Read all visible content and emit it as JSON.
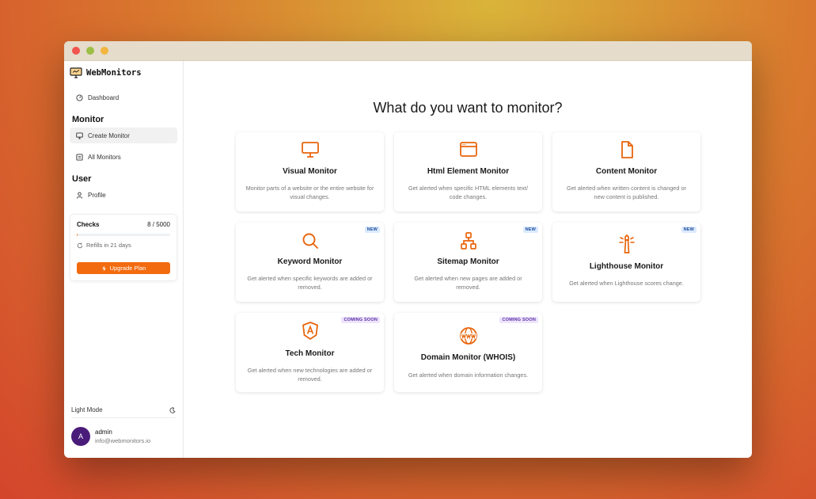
{
  "brand": {
    "name": "WebMonitors",
    "accent": "#f26b0f"
  },
  "sidebar": {
    "dashboard": "Dashboard",
    "sections": [
      {
        "title": "Monitor",
        "items": [
          "Create Monitor",
          "All Monitors"
        ]
      },
      {
        "title": "User",
        "items": [
          "Profile"
        ]
      }
    ],
    "checks": {
      "label": "Checks",
      "value": "8 / 5000",
      "used": 8,
      "limit": 5000,
      "refill": "Refills in 21 days",
      "upgrade": "Upgrade Plan"
    },
    "mode": "Light Mode",
    "user": {
      "initial": "A",
      "name": "admin",
      "email": "info@webmonitors.io"
    }
  },
  "main": {
    "title": "What do you want to monitor?",
    "cards": [
      {
        "name": "Visual Monitor",
        "desc": "Monitor parts of a website or the entire website for visual changes.",
        "icon": "monitor-icon",
        "badge": ""
      },
      {
        "name": "Html Element Monitor",
        "desc": "Get alerted when specific HTML elements text/ code changes.",
        "icon": "browser-window-icon",
        "badge": ""
      },
      {
        "name": "Content Monitor",
        "desc": "Get alerted when written content is changed or new content is published.",
        "icon": "file-icon",
        "badge": ""
      },
      {
        "name": "Keyword Monitor",
        "desc": "Get alerted when specific keywords are added or removed.",
        "icon": "search-icon",
        "badge": "NEW"
      },
      {
        "name": "Sitemap Monitor",
        "desc": "Get alerted when new pages are added or removed.",
        "icon": "sitemap-icon",
        "badge": "NEW"
      },
      {
        "name": "Lighthouse Monitor",
        "desc": "Get alerted when Lighthouse scores change.",
        "icon": "lighthouse-icon",
        "badge": "NEW"
      },
      {
        "name": "Tech Monitor",
        "desc": "Get alerted when new technologies are added or removed.",
        "icon": "angular-shield-icon",
        "badge": "COMING SOON"
      },
      {
        "name": "Domain Monitor (WHOIS)",
        "desc": "Get alerted when domain information changes.",
        "icon": "globe-www-icon",
        "badge": "COMING SOON"
      }
    ]
  }
}
